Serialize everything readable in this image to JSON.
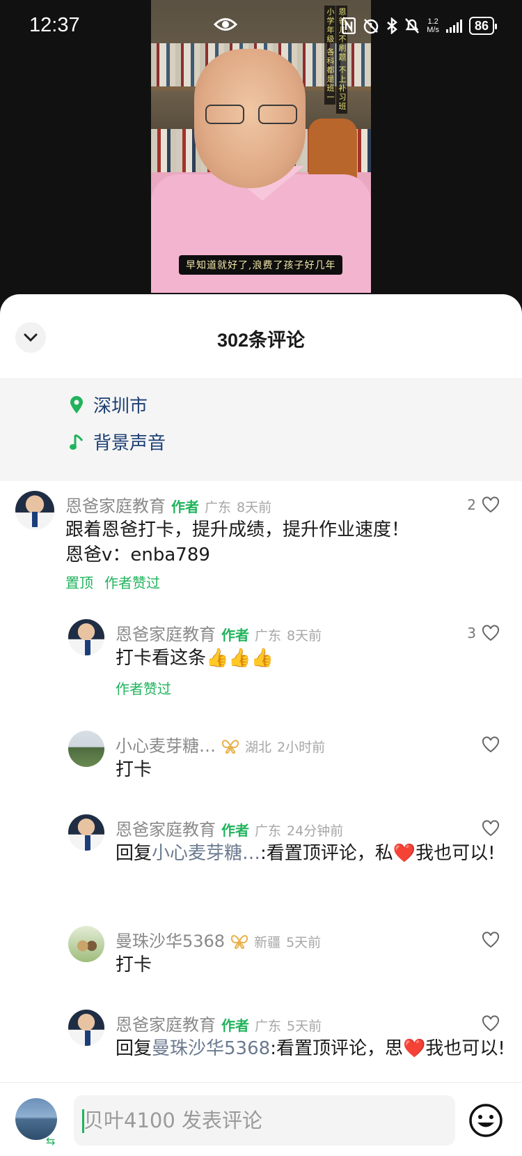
{
  "status_bar": {
    "time": "12:37",
    "network_speed_value": "1.2",
    "network_speed_unit": "M/s",
    "battery": "86",
    "icons": [
      "eye-icon",
      "nfc-icon",
      "alarm-icon",
      "bluetooth-icon",
      "mute-icon",
      "signal-icon",
      "battery-icon"
    ]
  },
  "video": {
    "vertical_text_1": "恩爸儿不刷题 不上补习班",
    "vertical_text_2": "小学年级 各科都是班一",
    "subtitle": "早知道就好了,浪费了孩子好几年"
  },
  "sheet": {
    "title": "302条评论",
    "location": "深圳市",
    "music": "背景声音"
  },
  "comments": [
    {
      "name": "恩爸家庭教育",
      "author_tag": "作者",
      "region": "广东",
      "time": "8天前",
      "likes": "2",
      "text_line1": "跟着恩爸打卡，提升成绩，提升作业速度！",
      "text_line2": "恩爸v：enba789",
      "tag_pinned": "置顶",
      "tag_liked": "作者赞过"
    },
    {
      "name": "恩爸家庭教育",
      "author_tag": "作者",
      "region": "广东",
      "time": "8天前",
      "likes": "3",
      "text": "打卡看这条👍👍👍",
      "tag_liked": "作者赞过"
    },
    {
      "name": "小心麦芽糖…",
      "region": "湖北",
      "time": "2小时前",
      "text": "打卡"
    },
    {
      "name": "恩爸家庭教育",
      "author_tag": "作者",
      "region": "广东",
      "time": "24分钟前",
      "reply_prefix": "回复",
      "reply_to": "小心麦芽糖…",
      "text": ":看置顶评论，私❤️我也可以!"
    },
    {
      "name": "曼珠沙华5368",
      "region": "新疆",
      "time": "5天前",
      "text": "打卡"
    },
    {
      "name": "恩爸家庭教育",
      "author_tag": "作者",
      "region": "广东",
      "time": "5天前",
      "reply_prefix": "回复",
      "reply_to": "曼珠沙华5368",
      "text": ":看置顶评论，思❤️我也可以!"
    }
  ],
  "input": {
    "placeholder": "贝叶4100 发表评论"
  },
  "colors": {
    "accent_green": "#20b35c",
    "link_blue": "#1d3f73",
    "badge_gold": "#e8b14a"
  }
}
